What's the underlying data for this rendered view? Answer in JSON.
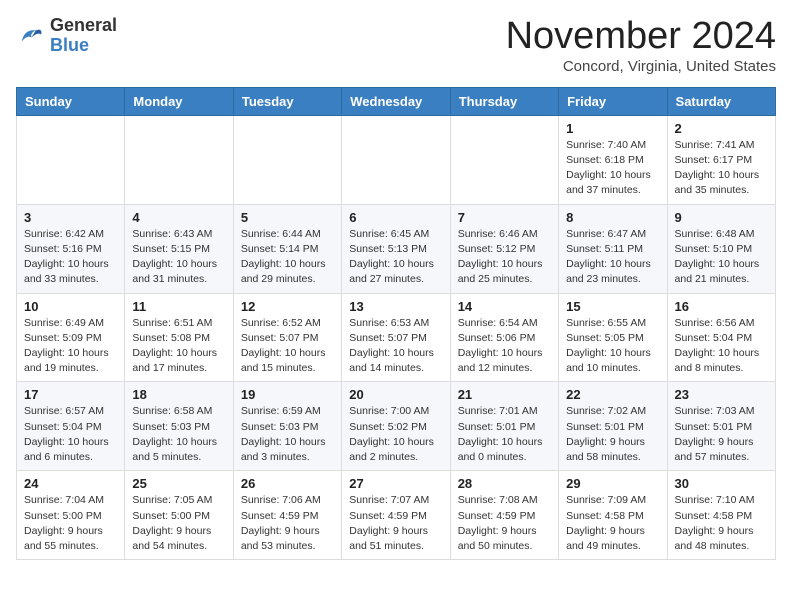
{
  "logo": {
    "general": "General",
    "blue": "Blue"
  },
  "header": {
    "month": "November 2024",
    "location": "Concord, Virginia, United States"
  },
  "weekdays": [
    "Sunday",
    "Monday",
    "Tuesday",
    "Wednesday",
    "Thursday",
    "Friday",
    "Saturday"
  ],
  "weeks": [
    [
      {
        "day": "",
        "info": ""
      },
      {
        "day": "",
        "info": ""
      },
      {
        "day": "",
        "info": ""
      },
      {
        "day": "",
        "info": ""
      },
      {
        "day": "",
        "info": ""
      },
      {
        "day": "1",
        "info": "Sunrise: 7:40 AM\nSunset: 6:18 PM\nDaylight: 10 hours and 37 minutes."
      },
      {
        "day": "2",
        "info": "Sunrise: 7:41 AM\nSunset: 6:17 PM\nDaylight: 10 hours and 35 minutes."
      }
    ],
    [
      {
        "day": "3",
        "info": "Sunrise: 6:42 AM\nSunset: 5:16 PM\nDaylight: 10 hours and 33 minutes."
      },
      {
        "day": "4",
        "info": "Sunrise: 6:43 AM\nSunset: 5:15 PM\nDaylight: 10 hours and 31 minutes."
      },
      {
        "day": "5",
        "info": "Sunrise: 6:44 AM\nSunset: 5:14 PM\nDaylight: 10 hours and 29 minutes."
      },
      {
        "day": "6",
        "info": "Sunrise: 6:45 AM\nSunset: 5:13 PM\nDaylight: 10 hours and 27 minutes."
      },
      {
        "day": "7",
        "info": "Sunrise: 6:46 AM\nSunset: 5:12 PM\nDaylight: 10 hours and 25 minutes."
      },
      {
        "day": "8",
        "info": "Sunrise: 6:47 AM\nSunset: 5:11 PM\nDaylight: 10 hours and 23 minutes."
      },
      {
        "day": "9",
        "info": "Sunrise: 6:48 AM\nSunset: 5:10 PM\nDaylight: 10 hours and 21 minutes."
      }
    ],
    [
      {
        "day": "10",
        "info": "Sunrise: 6:49 AM\nSunset: 5:09 PM\nDaylight: 10 hours and 19 minutes."
      },
      {
        "day": "11",
        "info": "Sunrise: 6:51 AM\nSunset: 5:08 PM\nDaylight: 10 hours and 17 minutes."
      },
      {
        "day": "12",
        "info": "Sunrise: 6:52 AM\nSunset: 5:07 PM\nDaylight: 10 hours and 15 minutes."
      },
      {
        "day": "13",
        "info": "Sunrise: 6:53 AM\nSunset: 5:07 PM\nDaylight: 10 hours and 14 minutes."
      },
      {
        "day": "14",
        "info": "Sunrise: 6:54 AM\nSunset: 5:06 PM\nDaylight: 10 hours and 12 minutes."
      },
      {
        "day": "15",
        "info": "Sunrise: 6:55 AM\nSunset: 5:05 PM\nDaylight: 10 hours and 10 minutes."
      },
      {
        "day": "16",
        "info": "Sunrise: 6:56 AM\nSunset: 5:04 PM\nDaylight: 10 hours and 8 minutes."
      }
    ],
    [
      {
        "day": "17",
        "info": "Sunrise: 6:57 AM\nSunset: 5:04 PM\nDaylight: 10 hours and 6 minutes."
      },
      {
        "day": "18",
        "info": "Sunrise: 6:58 AM\nSunset: 5:03 PM\nDaylight: 10 hours and 5 minutes."
      },
      {
        "day": "19",
        "info": "Sunrise: 6:59 AM\nSunset: 5:03 PM\nDaylight: 10 hours and 3 minutes."
      },
      {
        "day": "20",
        "info": "Sunrise: 7:00 AM\nSunset: 5:02 PM\nDaylight: 10 hours and 2 minutes."
      },
      {
        "day": "21",
        "info": "Sunrise: 7:01 AM\nSunset: 5:01 PM\nDaylight: 10 hours and 0 minutes."
      },
      {
        "day": "22",
        "info": "Sunrise: 7:02 AM\nSunset: 5:01 PM\nDaylight: 9 hours and 58 minutes."
      },
      {
        "day": "23",
        "info": "Sunrise: 7:03 AM\nSunset: 5:01 PM\nDaylight: 9 hours and 57 minutes."
      }
    ],
    [
      {
        "day": "24",
        "info": "Sunrise: 7:04 AM\nSunset: 5:00 PM\nDaylight: 9 hours and 55 minutes."
      },
      {
        "day": "25",
        "info": "Sunrise: 7:05 AM\nSunset: 5:00 PM\nDaylight: 9 hours and 54 minutes."
      },
      {
        "day": "26",
        "info": "Sunrise: 7:06 AM\nSunset: 4:59 PM\nDaylight: 9 hours and 53 minutes."
      },
      {
        "day": "27",
        "info": "Sunrise: 7:07 AM\nSunset: 4:59 PM\nDaylight: 9 hours and 51 minutes."
      },
      {
        "day": "28",
        "info": "Sunrise: 7:08 AM\nSunset: 4:59 PM\nDaylight: 9 hours and 50 minutes."
      },
      {
        "day": "29",
        "info": "Sunrise: 7:09 AM\nSunset: 4:58 PM\nDaylight: 9 hours and 49 minutes."
      },
      {
        "day": "30",
        "info": "Sunrise: 7:10 AM\nSunset: 4:58 PM\nDaylight: 9 hours and 48 minutes."
      }
    ]
  ]
}
